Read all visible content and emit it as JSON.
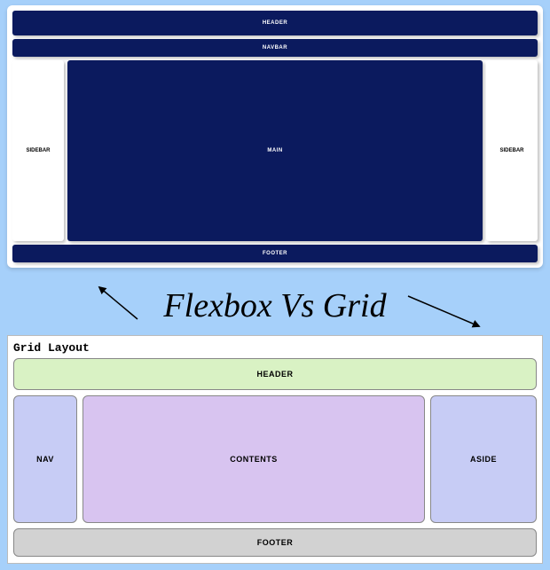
{
  "title": "Flexbox Vs Grid",
  "flexbox": {
    "header": "HEADER",
    "navbar": "NAVBAR",
    "sidebar_left": "SIDEBAR",
    "main": "MAIN",
    "sidebar_right": "SIDEBAR",
    "footer": "FOOTER"
  },
  "grid": {
    "title": "Grid Layout",
    "header": "HEADER",
    "nav": "NAV",
    "contents": "CONTENTS",
    "aside": "ASIDE",
    "footer": "FOOTER"
  }
}
